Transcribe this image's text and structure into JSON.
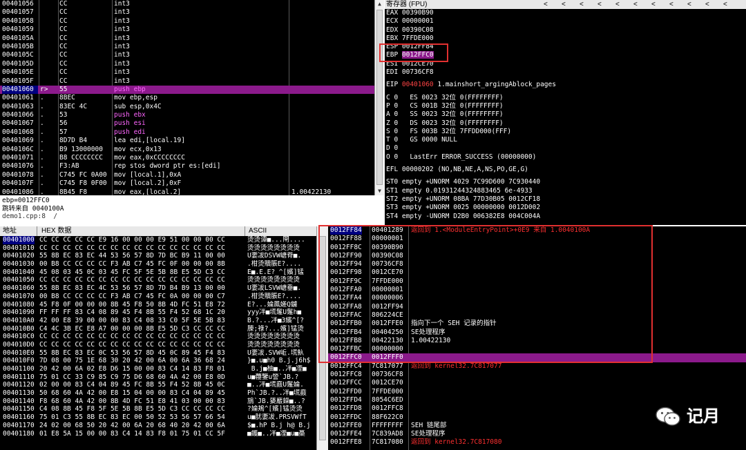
{
  "disasm": {
    "rows": [
      {
        "addr": "00401056",
        "mark": "",
        "hex": "CC",
        "ins": "int3",
        "cls": "op-int3",
        "cmt": ""
      },
      {
        "addr": "00401057",
        "mark": "",
        "hex": "CC",
        "ins": "int3",
        "cls": "op-int3",
        "cmt": ""
      },
      {
        "addr": "00401058",
        "mark": "",
        "hex": "CC",
        "ins": "int3",
        "cls": "op-int3",
        "cmt": ""
      },
      {
        "addr": "00401059",
        "mark": "",
        "hex": "CC",
        "ins": "int3",
        "cls": "op-int3",
        "cmt": ""
      },
      {
        "addr": "0040105A",
        "mark": "",
        "hex": "CC",
        "ins": "int3",
        "cls": "op-int3",
        "cmt": ""
      },
      {
        "addr": "0040105B",
        "mark": "",
        "hex": "CC",
        "ins": "int3",
        "cls": "op-int3",
        "cmt": ""
      },
      {
        "addr": "0040105C",
        "mark": "",
        "hex": "CC",
        "ins": "int3",
        "cls": "op-int3",
        "cmt": ""
      },
      {
        "addr": "0040105D",
        "mark": "",
        "hex": "CC",
        "ins": "int3",
        "cls": "op-int3",
        "cmt": ""
      },
      {
        "addr": "0040105E",
        "mark": "",
        "hex": "CC",
        "ins": "int3",
        "cls": "op-int3",
        "cmt": ""
      },
      {
        "addr": "0040105F",
        "mark": "",
        "hex": "CC",
        "ins": "int3",
        "cls": "op-int3",
        "cmt": ""
      },
      {
        "addr": "00401060",
        "mark": "r>",
        "hex": "55",
        "ins": "push ebp",
        "cls": "op-push",
        "cmt": "",
        "sel": true
      },
      {
        "addr": "00401061",
        "mark": ".",
        "hex": "8BEC",
        "ins": "mov ebp,esp",
        "cls": "op-normal",
        "cmt": ""
      },
      {
        "addr": "00401063",
        "mark": ".",
        "hex": "83EC 4C",
        "ins": "sub esp,0x4C",
        "cls": "op-normal",
        "cmt": ""
      },
      {
        "addr": "00401066",
        "mark": ".",
        "hex": "53",
        "ins": "push ebx",
        "cls": "op-push",
        "cmt": ""
      },
      {
        "addr": "00401067",
        "mark": ".",
        "hex": "56",
        "ins": "push esi",
        "cls": "op-push",
        "cmt": ""
      },
      {
        "addr": "00401068",
        "mark": ".",
        "hex": "57",
        "ins": "push edi",
        "cls": "op-push",
        "cmt": ""
      },
      {
        "addr": "00401069",
        "mark": ".",
        "hex": "8D7D B4",
        "ins": "lea edi,[local.19]",
        "cls": "op-normal",
        "cmt": ""
      },
      {
        "addr": "0040106C",
        "mark": ".",
        "hex": "B9 13000000",
        "ins": "mov ecx,0x13",
        "cls": "op-normal",
        "cmt": ""
      },
      {
        "addr": "00401071",
        "mark": ".",
        "hex": "B8 CCCCCCCC",
        "ins": "mov eax,0xCCCCCCCC",
        "cls": "op-normal",
        "cmt": ""
      },
      {
        "addr": "00401076",
        "mark": ".",
        "hex": "F3:AB",
        "ins": "rep stos dword ptr es:[edi]",
        "cls": "op-normal",
        "cmt": ""
      },
      {
        "addr": "00401078",
        "mark": ".",
        "hex": "C745 FC 0A00",
        "ins": "mov [local.1],0xA",
        "cls": "op-normal",
        "cmt": ""
      },
      {
        "addr": "0040107F",
        "mark": ".",
        "hex": "C745 F8 0F00",
        "ins": "mov [local.2],0xF",
        "cls": "op-normal",
        "cmt": ""
      },
      {
        "addr": "00401086",
        "mark": ".",
        "hex": "8B45 F8",
        "ins": "mov eax,[local.2]",
        "cls": "op-normal",
        "cmt": "1.00422130"
      }
    ]
  },
  "info": {
    "line1": "ebp=0012FFC0",
    "line2": "跳转来自 0040100A",
    "line3": "demo1.cpp:8  /"
  },
  "regs": {
    "title": "寄存器 (FPU)",
    "chevrons": [
      "<",
      "<",
      "<",
      "<",
      "<",
      "<",
      "<",
      "<",
      "<",
      "<",
      "<"
    ],
    "lines": [
      {
        "t": "EAX 00390B90"
      },
      {
        "t": "ECX 00000001"
      },
      {
        "t": "EDX 00390C08"
      },
      {
        "t": "EBX 7FFDE000"
      },
      {
        "t": "ESP 0012FF84"
      },
      {
        "t": "EBP ",
        "hl": "0012FFC0"
      },
      {
        "t": "ESI 0012CE70"
      },
      {
        "t": "EDI 00736CF8"
      },
      {
        "gap": true
      },
      {
        "t": "EIP ",
        "red": "00401060",
        "rest": " 1.mainshort_argingAblock_pages"
      },
      {
        "gap": true
      },
      {
        "t": "C 0   ES 0023 32位 0(FFFFFFFF)"
      },
      {
        "t": "P 0   CS 001B 32位 0(FFFFFFFF)"
      },
      {
        "t": "A 0   SS 0023 32位 0(FFFFFFFF)"
      },
      {
        "t": "Z 0   DS 0023 32位 0(FFFFFFFF)"
      },
      {
        "t": "S 0   FS 003B 32位 7FFDD000(FFF)"
      },
      {
        "t": "T 0   GS 0000 NULL"
      },
      {
        "t": "D 0"
      },
      {
        "t": "O 0   LastErr ERROR_SUCCESS (00000000)"
      },
      {
        "gap": true
      },
      {
        "t": "EFL 00000202 (NO,NB,NE,A,NS,PO,GE,G)"
      },
      {
        "gap": true
      },
      {
        "t": "ST0 empty +UNORM 4029 7C99D600 7C930440"
      },
      {
        "t": "ST1 empty 0.01931244324883465 6e-4933"
      },
      {
        "t": "ST2 empty +UNORM 08BA 77D30B05 0012CF18"
      },
      {
        "t": "ST3 empty +UNORM 0025 00000000 0012D002"
      },
      {
        "t": "ST4 empty -UNORM D2B0 006382E8 004C004A"
      }
    ]
  },
  "dump": {
    "col_addr": "地址",
    "col_hex": "HEX 数据",
    "col_ascii": "ASCII",
    "rows": [
      {
        "a": "00401000",
        "h": "CC CC CC CC CC E9 16 00 00 00 E9 51 00 00 00 CC",
        "s": "烫烫谭■...閈...."
      },
      {
        "a": "00401010",
        "h": "CC CC CC CC CC CC CC CC CC CC CC CC CC CC CC CC",
        "s": "烫烫烫烫烫烫烫烫"
      },
      {
        "a": "00401020",
        "h": "55 8B EC 83 EC 44 53 56 57 8D 7D BC B9 11 00 00",
        "s": "U嬱冹DSVW嵣脊■."
      },
      {
        "a": "00401030",
        "h": "00 B8 CC CC CC CC F3 AB C7 45 FC 0F 00 00 00 8B",
        "s": ".柑烫贖脹E?...."
      },
      {
        "a": "00401040",
        "h": "45 08 03 45 0C 03 45 FC 5F 5E 5B 8B E5 5D C3 CC",
        "s": "E■.E.E?_^[嬪]锰"
      },
      {
        "a": "00401050",
        "h": "CC CC CC CC CC CC CC CC CC CC CC CC CC CC CC CC",
        "s": "烫烫烫烫烫烫烫烫"
      },
      {
        "a": "00401060",
        "h": "55 8B EC 83 EC 4C 53 56 57 8D 7D B4 B9 13 00 00",
        "s": "U嬱冹LSVW嵣垂■."
      },
      {
        "a": "00401070",
        "h": "00 B8 CC CC CC CC F3 AB C7 45 FC 0A 00 00 00 C7",
        "s": ".柑烫贖脹E?...."
      },
      {
        "a": "00401080",
        "h": "45 F8 0F 00 00 00 8B 45 F8 50 8B 4D FC 51 E8 72",
        "s": "E?...婨鳳嫅Q鑢"
      },
      {
        "a": "00401090",
        "h": "FF FF FF 83 C4 08 89 45 F4 8B 55 F4 52 68 1C 20",
        "s": "yyy冸■塃鬔U鬔h■"
      },
      {
        "a": "004010A0",
        "h": "42 00 E8 39 00 00 00 83 C4 08 33 C0 5F 5E 5B 83",
        "s": "B.?...冸■3繽^[?"
      },
      {
        "a": "004010B0",
        "h": "C4 4C 3B EC E8 A7 00 00 00 8B E5 5D C3 CC CC CC",
        "s": "腖;祿?...嬪]锰烫"
      },
      {
        "a": "004010C0",
        "h": "CC CC CC CC CC CC CC CC CC CC CC CC CC CC CC CC",
        "s": "烫烫烫烫烫烫烫烫"
      },
      {
        "a": "004010D0",
        "h": "CC CC CC CC CC CC CC CC CC CC CC CC CC CC CC CC",
        "s": "烫烫烫烫烫烫烫烫"
      },
      {
        "a": "004010E0",
        "h": "55 8B EC 83 EC 0C 53 56 57 8D 45 0C 89 45 F4 83",
        "s": "U嬱冹.SVW岴.塃魞"
      },
      {
        "a": "004010F0",
        "h": "7D 08 00 75 1E 68 30 20 42 00 6A 00 6A 36 68 24",
        "s": "}■.u■h0 B.j.j6h$"
      },
      {
        "a": "00401100",
        "h": "20 42 00 6A 02 E8 D6 15 00 00 83 C4 14 83 F8 01",
        "s": " B.j■柚■..冸■凐■"
      },
      {
        "a": "00401110",
        "h": "75 01 CC 33 C9 85 C9 75 D6 68 60 4A 42 00 E8 0D",
        "s": "u■蘉鑒u謍`JB.?"
      },
      {
        "a": "00401120",
        "h": "02 00 00 83 C4 04 89 45 FC 8B 55 F4 52 8B 45 0C",
        "s": "■..冸■塃鼖U鬔婨."
      },
      {
        "a": "00401130",
        "s": "Ph`JB.?..冸■塃鼖",
        "h": "50 68 60 4A 42 00 E8 15 04 00 00 83 C4 04 89 45"
      },
      {
        "a": "00401140",
        "h": "F8 68 60 4A 42 00 8B 4D FC 51 E8 41 03 00 00 83",
        "s": "鴋`JB.婱黀鐰■..?"
      },
      {
        "a": "00401150",
        "h": "C4 08 8B 45 F8 5F 5E 5B 8B E5 5D C3 CC CC CC CC",
        "s": "?婨鴂^[嬪]锰烫烫"
      },
      {
        "a": "00401160",
        "h": "75 01 C3 55 8B EC 83 EC 00 50 52 53 56 57 66 54",
        "s": "u■肬嬱冹.PRSVWfT"
      },
      {
        "a": "00401170",
        "h": "24 02 00 68 50 20 42 00 6A 20 68 40 20 42 00 6A",
        "s": "$■.hP B.j h@ B.j"
      },
      {
        "a": "00401180",
        "h": "01 E8 5A 15 00 00 83 C4 14 83 F8 01 75 01 CC 5F",
        "s": "■鑊■..冸■凐■u■蘽"
      }
    ]
  },
  "stack": {
    "rows": [
      {
        "a": "0012FF84",
        "v": "00401289",
        "c": "返回到 1.<ModuleEntryPoint>+0E9 来自 1.0040100A",
        "red": true,
        "first": true
      },
      {
        "a": "0012FF88",
        "v": "00000001",
        "c": ""
      },
      {
        "a": "0012FF8C",
        "v": "00390B90",
        "c": ""
      },
      {
        "a": "0012FF90",
        "v": "00390C08",
        "c": ""
      },
      {
        "a": "0012FF94",
        "v": "00736CF8",
        "c": ""
      },
      {
        "a": "0012FF98",
        "v": "0012CE70",
        "c": ""
      },
      {
        "a": "0012FF9C",
        "v": "7FFDE000",
        "c": ""
      },
      {
        "a": "0012FFA0",
        "v": "00000001",
        "c": ""
      },
      {
        "a": "0012FFA4",
        "v": "00000006",
        "c": ""
      },
      {
        "a": "0012FFA8",
        "v": "0012FF94",
        "c": ""
      },
      {
        "a": "0012FFAC",
        "v": "806224CE",
        "c": ""
      },
      {
        "a": "0012FFB0",
        "v": "0012FFE0",
        "c": "指向下一个 SEH 记录的指针"
      },
      {
        "a": "0012FFB4",
        "v": "00404250",
        "c": "SE处理程序"
      },
      {
        "a": "0012FFB8",
        "v": "00422130",
        "c": "1.00422130"
      },
      {
        "a": "0012FFBC",
        "v": "00000000",
        "c": ""
      },
      {
        "a": "0012FFC0",
        "v": "0012FFF0",
        "c": "",
        "cur": true
      },
      {
        "a": "0012FFC4",
        "v": "7C817077",
        "c": "返回到 kernel32.7C817077",
        "red": true
      },
      {
        "a": "0012FFC8",
        "v": "00736CF8",
        "c": ""
      },
      {
        "a": "0012FFCC",
        "v": "0012CE70",
        "c": ""
      },
      {
        "a": "0012FFD0",
        "v": "7FFDE000",
        "c": ""
      },
      {
        "a": "0012FFD4",
        "v": "8054C6ED",
        "c": ""
      },
      {
        "a": "0012FFD8",
        "v": "0012FFC8",
        "c": ""
      },
      {
        "a": "0012FFDC",
        "v": "88F622C0",
        "c": ""
      },
      {
        "a": "0012FFE0",
        "v": "FFFFFFFF",
        "c": "SEH 链尾部"
      },
      {
        "a": "0012FFE4",
        "v": "7C839AD8",
        "c": "SE处理程序"
      },
      {
        "a": "0012FFE8",
        "v": "7C817080",
        "c": "返回到 kernel32.7C817080",
        "red": true
      }
    ]
  },
  "watermark": {
    "text": "记月",
    "icon": "wechat-logo"
  },
  "colors": {
    "selection": "#8b1a8b",
    "address_sel": "#000080",
    "highlight_box": "#e23030",
    "push": "#ff66ff"
  }
}
